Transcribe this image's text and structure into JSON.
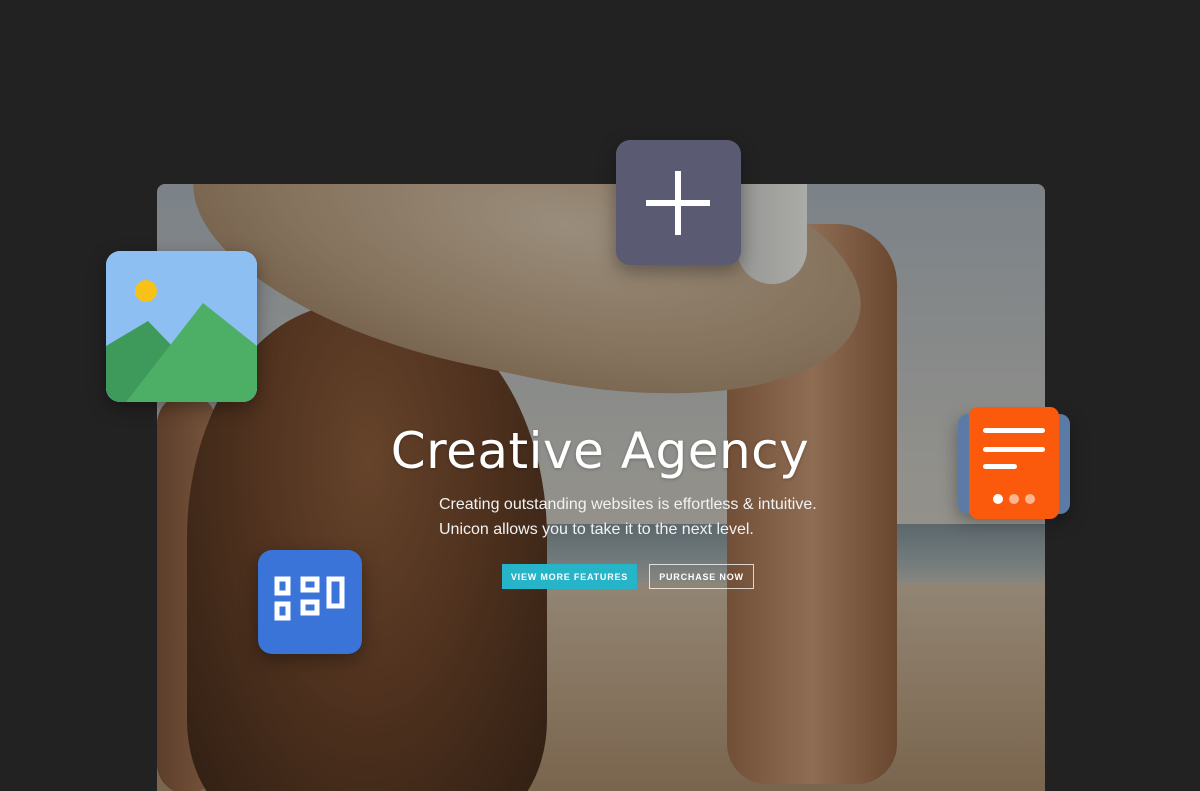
{
  "hero": {
    "title": "Creative Agency",
    "subtitle_line1": "Creating outstanding websites is effortless & intuitive.",
    "subtitle_line2": "Unicon allows you to take it to the next level.",
    "primary_button": "VIEW MORE FEATURES",
    "secondary_button": "PURCHASE NOW"
  },
  "floating_icons": [
    "plus-icon",
    "image-icon",
    "grid-layout-icon",
    "document-icon"
  ],
  "colors": {
    "page_background": "#222222",
    "primary_button": "#26b5c8",
    "plus_tile": "#5a5a72",
    "image_tile_sky": "#8ebff3",
    "grid_tile": "#3a74d8",
    "document_tile": "#fb5a0d",
    "document_tile_back": "#5b7aa6"
  }
}
